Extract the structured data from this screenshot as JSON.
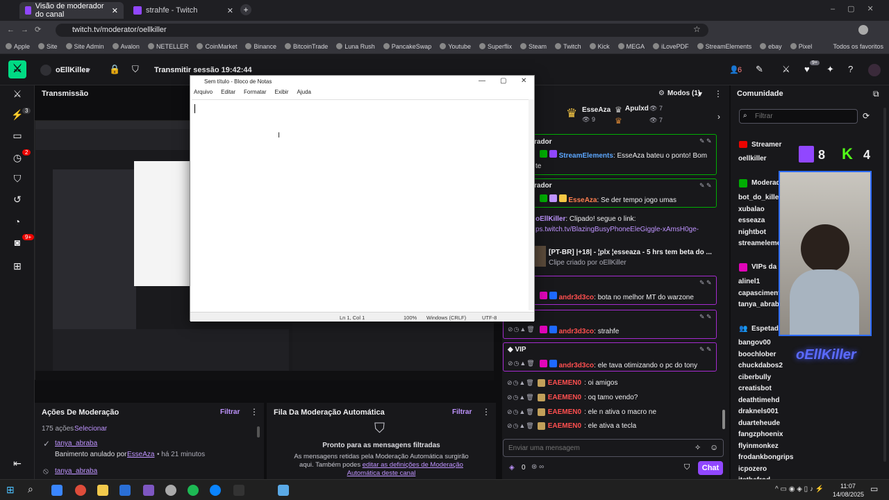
{
  "browser": {
    "tabs": [
      {
        "title": "Visão de moderador do canal"
      },
      {
        "title": "strahfe - Twitch"
      }
    ],
    "url": "twitch.tv/moderator/oellkiller",
    "bookmarks": [
      "Apple",
      "Site",
      "Site Admin",
      "Avalon",
      "NETELLER",
      "CoinMarket",
      "Binance",
      "BitcoinTrade",
      "Luna Rush",
      "PancakeSwap",
      "Youtube",
      "Superflix",
      "Steam",
      "Twitch",
      "Kick",
      "MEGA",
      "iLovePDF",
      "StreamElements",
      "ebay",
      "Pixel"
    ],
    "all_bookmarks": "Todos os favoritos"
  },
  "topbar": {
    "channel": "oEllKiller",
    "session": "Transmitir sessão 19:42:44",
    "viewers": "6",
    "notif_count": "9+"
  },
  "rail": {
    "badges": [
      "3",
      "2",
      "9+"
    ]
  },
  "transmission": {
    "title": "Transmissão"
  },
  "notepad": {
    "title": "Sem título - Bloco de Notas",
    "menu": [
      "Arquivo",
      "Editar",
      "Formatar",
      "Exibir",
      "Ajuda"
    ],
    "status": {
      "position": "Ln 1, Col 1",
      "zoom": "100%",
      "eol": "Windows (CRLF)",
      "encoding": "UTF-8"
    }
  },
  "mod_actions": {
    "title": "Ações De Moderação",
    "filter": "Filtrar",
    "count": "175 ações",
    "select": "Selecionar",
    "items": [
      {
        "user": "tanya_abraba",
        "text": "Banimento anulado por",
        "by": "EsseAza",
        "time": "• há 21 minutos"
      },
      {
        "user": "tanya_abraba"
      }
    ]
  },
  "automod": {
    "title": "Fila Da Moderação Automática",
    "filter": "Filtrar",
    "heading": "Pronto para as mensagens filtradas",
    "body": "As mensagens retidas pela Moderação Automática surgirão aqui. Também podes",
    "link": "editar as definições de Moderação Automática deste canal"
  },
  "chat": {
    "modes": "Modos (1)",
    "leaders": [
      {
        "name": "EsseAza",
        "count": "9"
      },
      {
        "name": "Apulxd",
        "count": "7"
      },
      {
        "count": "7"
      }
    ],
    "moderator_label": "rador",
    "msgs": [
      {
        "user": "StreamElements",
        "text": ": EsseAza bateu o ponto! Bom",
        "cont": "te"
      },
      {
        "user": "EsseAza",
        "text": ": Se der tempo jogo umas"
      },
      {
        "user": "oEllKiller",
        "text": ": Clipado! segue o link:",
        "link": "ps.twitch.tv/BlazingBusyPhoneEleGiggle-xAmsH0ge-"
      },
      {
        "clip_title": "[PT-BR] |+18| - ¦plx ¦esseaza - 5 hrs tem beta do ...",
        "clip_by": "Clipe criado por oEllKiller"
      },
      {
        "user": "andr3d3co",
        "text": ": bota no melhor MT do warzone"
      },
      {
        "user": "andr3d3co",
        "text": ": strahfe"
      },
      {
        "badge": "VIP",
        "user": "andr3d3co",
        "text": ": ele tava otimizando o pc do tony"
      },
      {
        "user": "EAEMEN0",
        "text": ": oi amigos"
      },
      {
        "user": "EAEMEN0",
        "text": ": oq tamo vendo?"
      },
      {
        "user": "EAEMEN0",
        "text": ": ele n ativa o macro ne"
      },
      {
        "user": "EAEMEN0",
        "text": ": ele ativa a tecla"
      }
    ],
    "input_placeholder": "Enviar uma mensagem",
    "points": "0",
    "send": "Chat"
  },
  "community": {
    "title": "Comunidade",
    "filter_placeholder": "Filtrar",
    "streamer_label": "Streamer",
    "streamer": "oellkiller",
    "twitch_count": "8",
    "kick_count": "4",
    "mod_label": "Moderador",
    "mods": [
      "bot_do_killer",
      "xubalao",
      "esseaza",
      "nightbot",
      "streameleme"
    ],
    "vip_label": "VIPs da c",
    "vips": [
      "alinel1",
      "capasciment",
      "tanya_abrab"
    ],
    "viewer_label": "Espetado",
    "viewers": [
      "bangov00",
      "boochlober",
      "chuckdabos2",
      "ciberbully",
      "creatisbot",
      "deathtimehd",
      "draknels001",
      "duarteheude",
      "fangzphoenix",
      "flyinmonkez",
      "frodankbongrips",
      "icpozero",
      "itsthefrod"
    ]
  },
  "taskbar": {
    "time": "11:07",
    "date": "14/08/2025"
  },
  "colors": {
    "accent": "#9147ff",
    "twitch_green": "#00db84",
    "mod_green": "#00ad03",
    "bg": "#0e0e10"
  }
}
